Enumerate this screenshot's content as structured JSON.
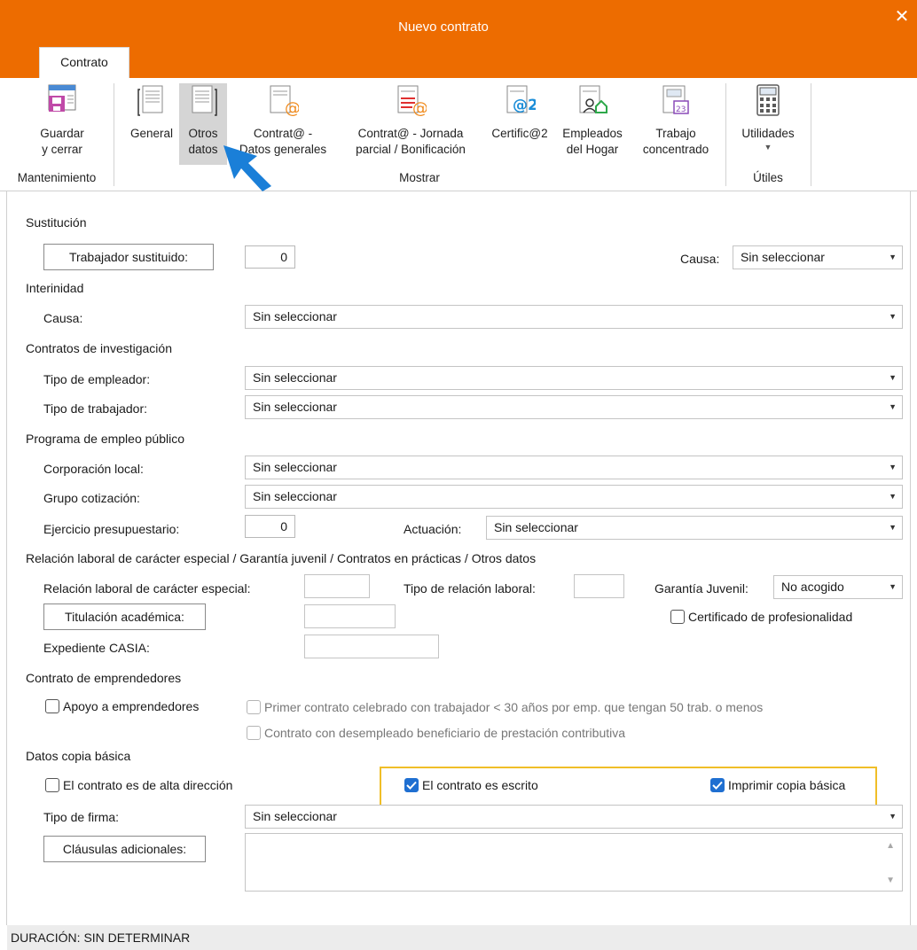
{
  "window": {
    "title": "Nuevo contrato"
  },
  "ribbon": {
    "tab": "Contrato",
    "buttons": {
      "guardar_l1": "Guardar",
      "guardar_l2": "y cerrar",
      "general": "General",
      "otros_l1": "Otros",
      "otros_l2": "datos",
      "contrat_dg_l1": "Contrat@ -",
      "contrat_dg_l2": "Datos generales",
      "contrat_jp_l1": "Contrat@ - Jornada",
      "contrat_jp_l2": "parcial / Bonificación",
      "certific_l1": "Certific@2",
      "certific_l2": "",
      "empleados_l1": "Empleados",
      "empleados_l2": "del Hogar",
      "trabajo_l1": "Trabajo",
      "trabajo_l2": "concentrado",
      "utilidades": "Utilidades"
    },
    "groups": {
      "mantenimiento": "Mantenimiento",
      "mostrar": "Mostrar",
      "utiles": "Útiles"
    }
  },
  "form": {
    "sustitucion": {
      "title": "Sustitución",
      "trabajador_btn": "Trabajador sustituido:",
      "trabajador_value": "0",
      "causa_label": "Causa:",
      "causa_value": "Sin seleccionar"
    },
    "interinidad": {
      "title": "Interinidad",
      "causa_label": "Causa:",
      "causa_value": "Sin seleccionar"
    },
    "investigacion": {
      "title": "Contratos de investigación",
      "empleador_label": "Tipo de empleador:",
      "empleador_value": "Sin seleccionar",
      "trabajador_label": "Tipo de trabajador:",
      "trabajador_value": "Sin seleccionar"
    },
    "empleo_publico": {
      "title": "Programa de empleo público",
      "corporacion_label": "Corporación local:",
      "corporacion_value": "Sin seleccionar",
      "grupo_label": "Grupo cotización:",
      "grupo_value": "Sin seleccionar",
      "ejercicio_label": "Ejercicio presupuestario:",
      "ejercicio_value": "0",
      "actuacion_label": "Actuación:",
      "actuacion_value": "Sin seleccionar"
    },
    "relacion": {
      "title": "Relación laboral de carácter especial / Garantía juvenil / Contratos en prácticas / Otros datos",
      "especial_label": "Relación laboral de carácter especial:",
      "tipo_label": "Tipo de relación laboral:",
      "garantia_label": "Garantía Juvenil:",
      "garantia_value": "No acogido",
      "titulacion_btn": "Titulación académica:",
      "certificado_label": "Certificado de profesionalidad",
      "casia_label": "Expediente CASIA:"
    },
    "emprendedores": {
      "title": "Contrato de emprendedores",
      "apoyo_label": "Apoyo a emprendedores",
      "primer_label": "Primer contrato celebrado con trabajador < 30 años por emp. que tengan 50 trab. o menos",
      "desempleado_label": "Contrato con desempleado beneficiario de prestación contributiva"
    },
    "copia_basica": {
      "title": "Datos copia básica",
      "alta_label": "El contrato es de alta dirección",
      "escrito_label": "El contrato es escrito",
      "imprimir_label": "Imprimir copia básica",
      "firma_label": "Tipo de firma:",
      "firma_value": "Sin seleccionar",
      "clausulas_btn": "Cláusulas adicionales:"
    }
  },
  "status": {
    "duracion": "DURACIÓN: SIN DETERMINAR"
  },
  "colors": {
    "title_bar": "#ed6c00",
    "check_blue": "#1f6fd1",
    "highlight": "#f0be28",
    "cursor": "#1a7fd8"
  }
}
